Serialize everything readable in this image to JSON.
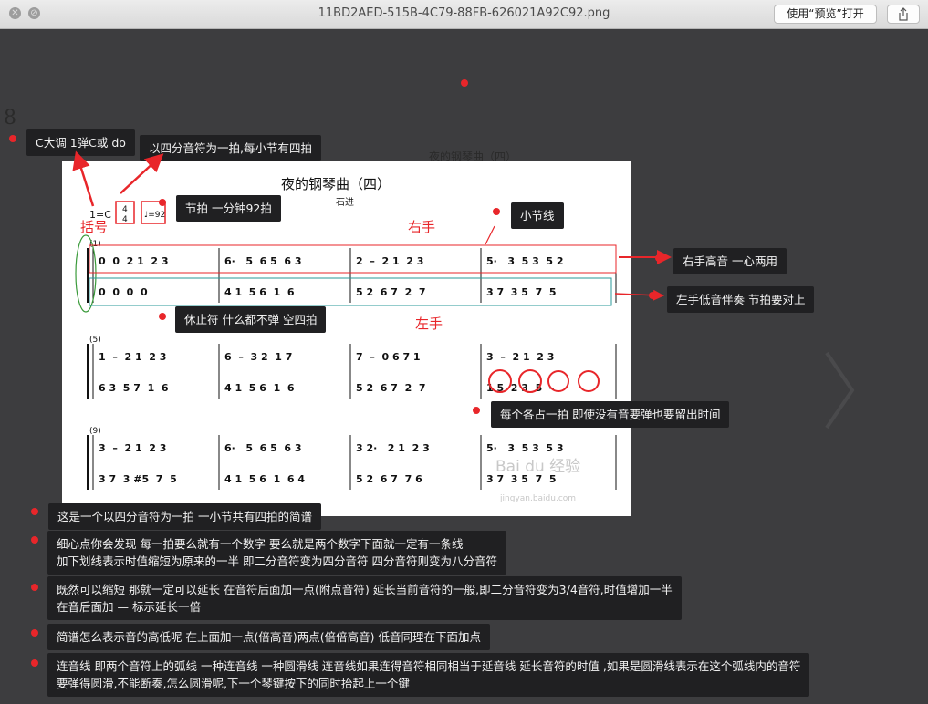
{
  "window": {
    "title": "11BD2AED-515B-4C79-88FB-626021A92C92.png",
    "open_button": "使用“预览”打开",
    "close_glyph": "✕",
    "min_glyph": "⊘"
  },
  "background_text": [
    "夜的钢琴曲（四）",
    "8"
  ],
  "score": {
    "title": "夜的钢琴曲（四）",
    "composer": "石进",
    "key": "1=C",
    "time_top": "4",
    "time_bottom": "4",
    "tempo": "♩=92",
    "measure_numbers": [
      "(1)",
      "(5)",
      "(9)"
    ],
    "watermark": "Bai du 经验",
    "watermark_url": "jingyan.baidu.com",
    "rows": [
      {
        "right": [
          "0  0  2 1  2 3",
          "6·   5  6 5  6 3",
          "2  –  2 1  2 3",
          "5·   3  5 3  5 2"
        ],
        "left": [
          "0  0  0  0",
          "4 1  5 6  1  6",
          "5 2  6 7  2  7",
          "3 7  3 5  7  5"
        ]
      },
      {
        "right": [
          "1  –  2 1  2 3",
          "6  –  3 2  1 7",
          "7  –  0 6 7 1",
          "3  –  2 1  2 3"
        ],
        "left": [
          "6 3  5 7  1  6",
          "4 1  5 6  1  6",
          "5 2  6 7  2  7",
          "1 5  2 3  5  –"
        ]
      },
      {
        "right": [
          "3  –  2 1  2 3",
          "6·   5  6 5  6 3",
          "3 2·   2 1  2 3",
          "5·   3  5 3  5 3"
        ],
        "left": [
          "3 7  3 #5  7  5",
          "4 1  5 6  1  6 4",
          "5 2  6 7  7 6",
          "3 7  3 5  7  5"
        ]
      }
    ]
  },
  "labels": {
    "brackets": "括号",
    "right_hand": "右手",
    "left_hand": "左手"
  },
  "annotations": {
    "key_note": "C大调 1弹C或 do",
    "beat_note": "以四分音符为一拍,每小节有四拍",
    "tempo_note": "节拍 一分钟92拍",
    "barline_note": "小节线",
    "right_high_note": "右手高音 一心两用",
    "left_low_note": "左手低音伴奏 节拍要对上",
    "rest_note": "休止符 什么都不弹 空四拍",
    "each_beat_note": "每个各占一拍 即使没有音要弹也要留出时间",
    "summary_1": "这是一个以四分音符为一拍 一小节共有四拍的简谱",
    "summary_2_line1": "细心点你会发现 每一拍要么就有一个数字 要么就是两个数字下面就一定有一条线",
    "summary_2_line2": "加下划线表示时值缩短为原来的一半 即二分音符变为四分音符 四分音符则变为八分音符",
    "summary_3_line1": "既然可以缩短 那就一定可以延长 在音符后面加一点(附点音符) 延长当前音符的一般,即二分音符变为3/4音符,时值增加一半",
    "summary_3_line2": "在音后面加 — 标示延长一倍",
    "summary_4": "简谱怎么表示音的高低呢  在上面加一点(倍高音)两点(倍倍高音) 低音同理在下面加点",
    "summary_5_line1": "连音线 即两个音符上的弧线 一种连音线 一种圆滑线 连音线如果连得音符相同相当于延音线 延长音符的时值 ,如果是圆滑线表示在这个弧线内的音符",
    "summary_5_line2": "要弹得圆滑,不能断奏,怎么圆滑呢,下一个琴键按下的同时抬起上一个键"
  },
  "colors": {
    "annotation_red": "#e8262a",
    "note_bg": "#202022",
    "teal_box": "#2a9a9a",
    "green_bracket": "#3a9a3a"
  }
}
